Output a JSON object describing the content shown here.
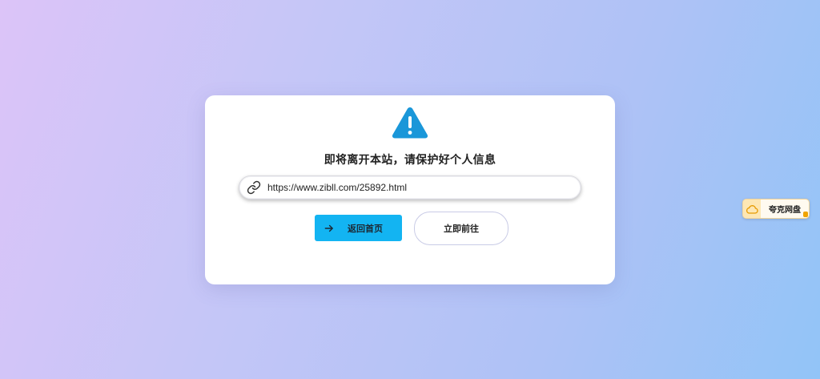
{
  "dialog": {
    "title": "即将离开本站，请保护好个人信息",
    "url": "https://www.zibll.com/25892.html",
    "back_home_label": "返回首页",
    "go_now_label": "立即前往"
  },
  "cloud_widget": {
    "label": "夸克网盘"
  },
  "icons": {
    "warning": "warning-triangle-icon",
    "link": "link-icon",
    "arrow": "arrow-right-icon",
    "cloud": "cloud-icon"
  },
  "colors": {
    "warning_icon": "#1a97d9",
    "primary_button": "#13b4f2",
    "cloud_accent": "#f0a400"
  }
}
